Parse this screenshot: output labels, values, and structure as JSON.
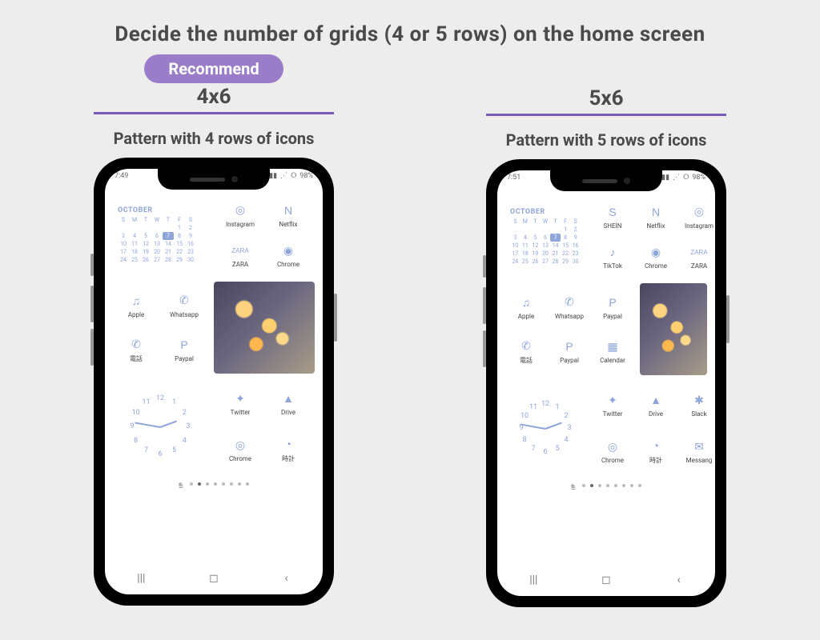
{
  "title": "Decide the number of grids (4 or 5 rows) on the home screen",
  "recommend_label": "Recommend",
  "left": {
    "grid_label": "4x6",
    "subtext": "Pattern with 4 rows of icons",
    "status_time": "7:49",
    "status_batt": "98%",
    "calendar_month": "OCTOBER",
    "calendar_today": "7",
    "apps_row1": [
      {
        "name": "instagram",
        "label": "Instagram",
        "glyph": "◎"
      },
      {
        "name": "netflix",
        "label": "Netflix",
        "glyph": "N"
      },
      {
        "name": "zara",
        "label": "ZARA",
        "glyph": "ZARA"
      },
      {
        "name": "chrome",
        "label": "Chrome",
        "glyph": "◉"
      }
    ],
    "apps_row2_left": [
      {
        "name": "apple",
        "label": "Apple",
        "glyph": "♫"
      },
      {
        "name": "whatsapp",
        "label": "Whatsapp",
        "glyph": "✆"
      },
      {
        "name": "phone",
        "label": "電話",
        "glyph": "✆"
      },
      {
        "name": "paypal",
        "label": "Paypal",
        "glyph": "P"
      }
    ],
    "apps_row3_right": [
      {
        "name": "twitter",
        "label": "Twitter",
        "glyph": "✦"
      },
      {
        "name": "drive",
        "label": "Drive",
        "glyph": "▲"
      },
      {
        "name": "chrome2",
        "label": "Chrome",
        "glyph": "◎"
      },
      {
        "name": "clock",
        "label": "時計",
        "glyph": "◔"
      }
    ]
  },
  "right": {
    "grid_label": "5x6",
    "subtext": "Pattern with 5 rows of icons",
    "status_time": "7:51",
    "status_batt": "98%",
    "calendar_month": "OCTOBER",
    "calendar_today": "7",
    "apps_row1": [
      {
        "name": "shein",
        "label": "SHEIN",
        "glyph": "S"
      },
      {
        "name": "netflix",
        "label": "Netflix",
        "glyph": "N"
      },
      {
        "name": "instagram",
        "label": "Instagram",
        "glyph": "◎"
      },
      {
        "name": "tiktok",
        "label": "TikTok",
        "glyph": "♪"
      },
      {
        "name": "chrome",
        "label": "Chrome",
        "glyph": "◉"
      },
      {
        "name": "zara",
        "label": "ZARA",
        "glyph": "ZARA"
      }
    ],
    "apps_row2_left": [
      {
        "name": "apple",
        "label": "Apple",
        "glyph": "♫"
      },
      {
        "name": "whatsapp",
        "label": "Whatsapp",
        "glyph": "✆"
      },
      {
        "name": "paypal",
        "label": "Paypal",
        "glyph": "P"
      },
      {
        "name": "phone",
        "label": "電話",
        "glyph": "✆"
      },
      {
        "name": "paypal2",
        "label": "Paypal",
        "glyph": "P"
      },
      {
        "name": "calendar",
        "label": "Calendar",
        "glyph": "▦"
      }
    ],
    "apps_row3_right": [
      {
        "name": "twitter",
        "label": "Twitter",
        "glyph": "✦"
      },
      {
        "name": "drive",
        "label": "Drive",
        "glyph": "▲"
      },
      {
        "name": "slack",
        "label": "Slack",
        "glyph": "✱"
      },
      {
        "name": "chrome2",
        "label": "Chrome",
        "glyph": "◎"
      },
      {
        "name": "clock",
        "label": "時計",
        "glyph": "◔"
      },
      {
        "name": "messenger",
        "label": "Messang",
        "glyph": "✉"
      }
    ]
  },
  "calendar_days": [
    "S",
    "M",
    "T",
    "W",
    "T",
    "F",
    "S"
  ],
  "calendar_grid": [
    [
      "",
      "",
      "",
      "",
      "",
      "1",
      "2"
    ],
    [
      "3",
      "4",
      "5",
      "6",
      "7",
      "8",
      "9"
    ],
    [
      "10",
      "11",
      "12",
      "13",
      "14",
      "15",
      "16"
    ],
    [
      "17",
      "18",
      "19",
      "20",
      "21",
      "22",
      "23"
    ],
    [
      "24",
      "25",
      "26",
      "27",
      "28",
      "29",
      "30"
    ]
  ],
  "clock_numbers": [
    "12",
    "1",
    "2",
    "3",
    "4",
    "5",
    "6",
    "7",
    "8",
    "9",
    "10",
    "11"
  ],
  "pager_count": 8,
  "nav": {
    "recents": "|||",
    "home": "◻",
    "back": "‹"
  }
}
